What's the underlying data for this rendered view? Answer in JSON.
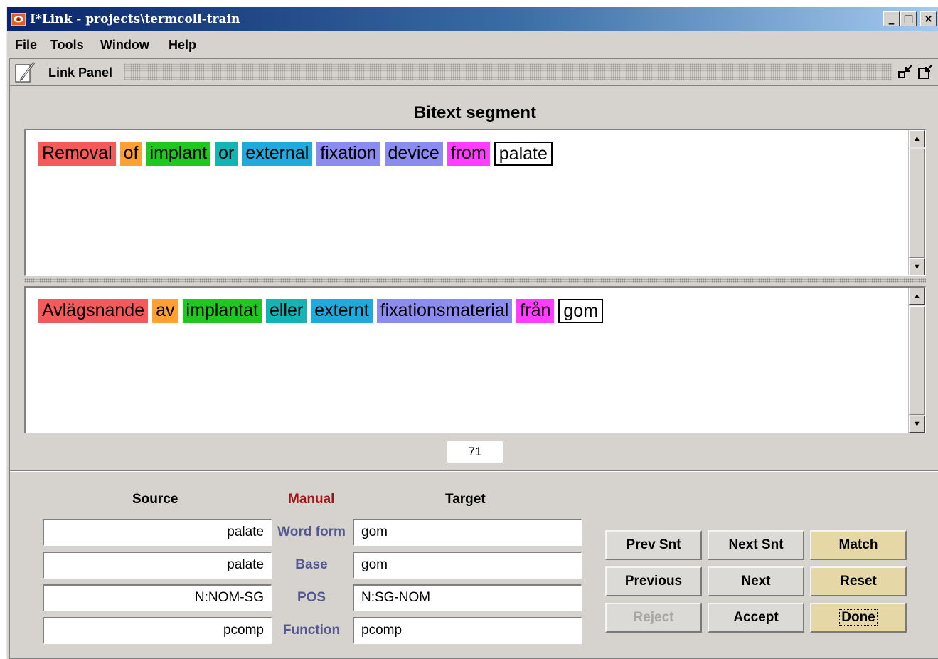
{
  "window": {
    "title": "I*Link - projects\\termcoll-train",
    "minimize_glyph": "_",
    "maximize_glyph": "□",
    "close_glyph": "×"
  },
  "menu": [
    "File",
    "Tools",
    "Window",
    "Help"
  ],
  "panel": {
    "title": "Link Panel"
  },
  "segment": {
    "title": "Bitext segment",
    "source_tokens": [
      {
        "text": "Removal",
        "color": "#f55a5a"
      },
      {
        "text": "of",
        "color": "#ffa033"
      },
      {
        "text": "implant",
        "color": "#1ec81e"
      },
      {
        "text": "or",
        "color": "#14b4b4"
      },
      {
        "text": "external",
        "color": "#1eaadc"
      },
      {
        "text": "fixation",
        "color": "#8c8cf0"
      },
      {
        "text": "device",
        "color": "#8c8cf0"
      },
      {
        "text": "from",
        "color": "#ff3cff"
      },
      {
        "text": "palate",
        "color": "#ffffff",
        "selected": true
      }
    ],
    "target_tokens": [
      {
        "text": "Avlägsnande",
        "color": "#f55a5a"
      },
      {
        "text": "av",
        "color": "#ffa033"
      },
      {
        "text": "implantat",
        "color": "#1ec81e"
      },
      {
        "text": "eller",
        "color": "#14b4b4"
      },
      {
        "text": "externt",
        "color": "#1eaadc"
      },
      {
        "text": "fixationsmaterial",
        "color": "#8c8cf0"
      },
      {
        "text": "från",
        "color": "#ff3cff"
      },
      {
        "text": "gom",
        "color": "#ffffff",
        "selected": true
      }
    ],
    "counter": "71"
  },
  "link_table": {
    "source_header": "Source",
    "mode_header": "Manual",
    "target_header": "Target",
    "mode_color": "#a01414",
    "rows": [
      {
        "label": "Word form",
        "source": "palate",
        "target": "gom"
      },
      {
        "label": "Base",
        "source": "palate",
        "target": "gom"
      },
      {
        "label": "POS",
        "source": "N:NOM-SG",
        "target": "N:SG-NOM"
      },
      {
        "label": "Function",
        "source": "pcomp",
        "target": "pcomp"
      }
    ]
  },
  "buttons": {
    "prev_snt": "Prev Snt",
    "next_snt": "Next Snt",
    "match": "Match",
    "previous": "Previous",
    "next": "Next",
    "reset": "Reset",
    "reject": "Reject",
    "accept": "Accept",
    "done": "Done"
  }
}
